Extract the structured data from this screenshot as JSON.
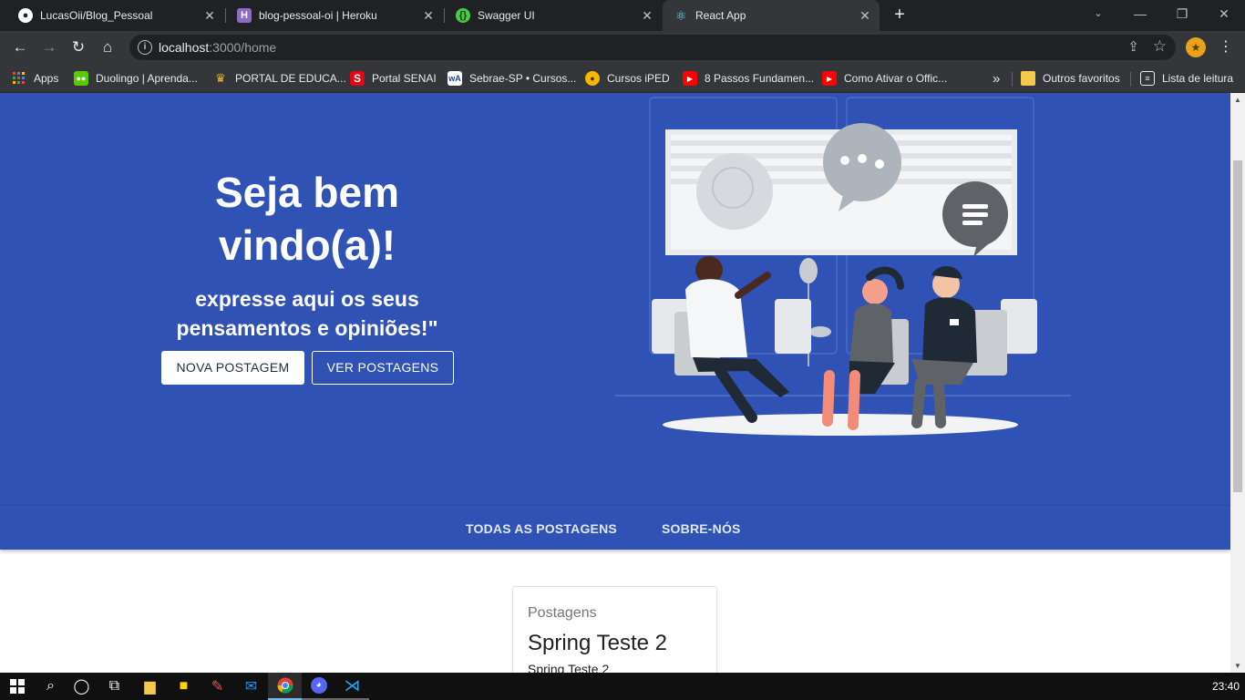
{
  "browser": {
    "tabs": [
      {
        "label": "LucasOii/Blog_Pessoal",
        "icon": "github-icon",
        "icon_bg": "#ffffff"
      },
      {
        "label": "blog-pessoal-oi | Heroku",
        "icon": "heroku-icon",
        "icon_bg": "#8d6bc6"
      },
      {
        "label": "Swagger UI",
        "icon": "swagger-icon",
        "icon_bg": "#49cc43"
      },
      {
        "label": "React App",
        "icon": "react-icon",
        "icon_bg": "#61dafb",
        "active": true
      }
    ],
    "address": {
      "host": "localhost",
      "path": ":3000/home"
    },
    "bookmarks": [
      {
        "label": "Apps",
        "icon": "apps-grid-icon"
      },
      {
        "label": "Duolingo | Aprenda...",
        "icon": "duolingo-icon"
      },
      {
        "label": "PORTAL DE EDUCA...",
        "icon": "crown-icon"
      },
      {
        "label": "Portal SENAI",
        "icon": "senai-icon"
      },
      {
        "label": "Sebrae-SP • Cursos...",
        "icon": "sebrae-icon"
      },
      {
        "label": "Cursos iPED",
        "icon": "iped-icon"
      },
      {
        "label": "8 Passos Fundamen...",
        "icon": "youtube-icon"
      },
      {
        "label": "Como Ativar o Offic...",
        "icon": "youtube-icon"
      },
      {
        "label": "»",
        "icon": "overflow-icon"
      },
      {
        "label": "Outros favoritos",
        "icon": "folder-icon"
      },
      {
        "label": "Lista de leitura",
        "icon": "reading-list-icon"
      }
    ]
  },
  "hero": {
    "title": "Seja bem vindo(a)!",
    "subtitle": "expresse aqui os seus pensamentos e opiniões!\"",
    "primary_button": "NOVA POSTAGEM",
    "secondary_button": "VER POSTAGENS"
  },
  "subnav": {
    "links": [
      "TODAS AS POSTAGENS",
      "SOBRE-NÓS"
    ]
  },
  "post_card": {
    "caption": "Postagens",
    "title": "Spring Teste 2",
    "text": "Spring Teste 2"
  },
  "taskbar": {
    "clock": "23:40"
  },
  "colors": {
    "hero_bg": "#3052b4",
    "chrome_dark": "#202124",
    "chrome_toolbar": "#35363a"
  }
}
